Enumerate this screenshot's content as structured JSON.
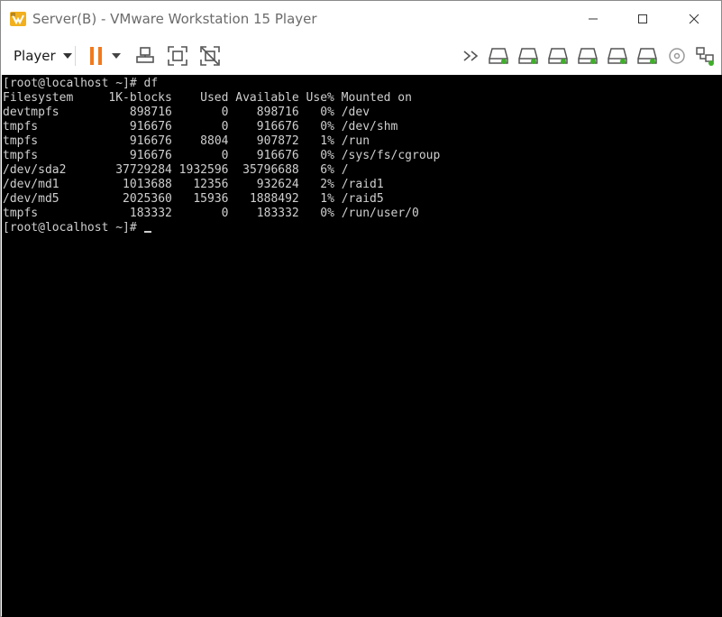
{
  "window": {
    "title": "Server(B) - VMware Workstation 15 Player",
    "controls": {
      "minimize": "minimize-icon",
      "maximize": "maximize-icon",
      "close": "close-icon"
    }
  },
  "toolbar": {
    "player_label": "Player",
    "icons": [
      "pause-icon",
      "dropdown-icon",
      "send-ctrl-alt-del-icon",
      "fullscreen-icon",
      "unity-icon",
      "more-devices-icon",
      "hard-disk-icon",
      "hard-disk-icon",
      "hard-disk-icon",
      "hard-disk-icon",
      "hard-disk-icon",
      "hard-disk-icon",
      "cd-dvd-icon",
      "network-adapter-icon"
    ],
    "pause_color": "#f07a1e",
    "device_active_color": "#3fae2a"
  },
  "console": {
    "prompt_line": "[root@localhost ~]# df",
    "header": "Filesystem     1K-blocks    Used Available Use% Mounted on",
    "rows": [
      {
        "filesystem": "devtmpfs",
        "blocks": "898716",
        "used": "0",
        "available": "898716",
        "use": "0%",
        "mounted": "/dev"
      },
      {
        "filesystem": "tmpfs",
        "blocks": "916676",
        "used": "0",
        "available": "916676",
        "use": "0%",
        "mounted": "/dev/shm"
      },
      {
        "filesystem": "tmpfs",
        "blocks": "916676",
        "used": "8804",
        "available": "907872",
        "use": "1%",
        "mounted": "/run"
      },
      {
        "filesystem": "tmpfs",
        "blocks": "916676",
        "used": "0",
        "available": "916676",
        "use": "0%",
        "mounted": "/sys/fs/cgroup"
      },
      {
        "filesystem": "/dev/sda2",
        "blocks": "37729284",
        "used": "1932596",
        "available": "35796688",
        "use": "6%",
        "mounted": "/"
      },
      {
        "filesystem": "/dev/md1",
        "blocks": "1013688",
        "used": "12356",
        "available": "932624",
        "use": "2%",
        "mounted": "/raid1"
      },
      {
        "filesystem": "/dev/md5",
        "blocks": "2025360",
        "used": "15936",
        "available": "1888492",
        "use": "1%",
        "mounted": "/raid5"
      },
      {
        "filesystem": "tmpfs",
        "blocks": "183332",
        "used": "0",
        "available": "183332",
        "use": "0%",
        "mounted": "/run/user/0"
      }
    ],
    "final_prompt": "[root@localhost ~]#"
  }
}
